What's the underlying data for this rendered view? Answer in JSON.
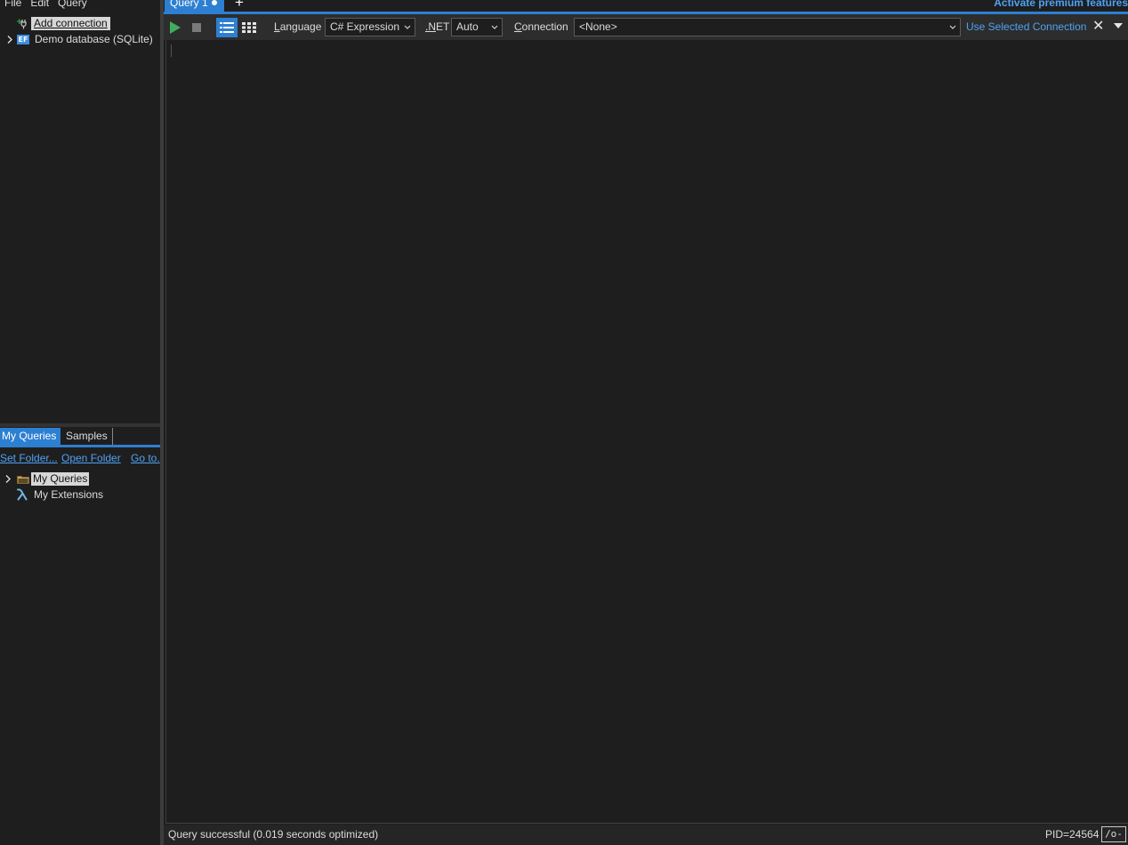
{
  "menu": [
    "File",
    "Edit",
    "Query"
  ],
  "connections": {
    "add_label": "Add connection",
    "items": [
      {
        "label": "Demo database (SQLite)",
        "badge": "EF"
      }
    ]
  },
  "query_panel": {
    "tabs": [
      "My Queries",
      "Samples"
    ],
    "links": [
      "Set Folder...",
      "Open Folder",
      "Go to."
    ],
    "tree": [
      {
        "label": "My Queries",
        "icon": "folder-icon"
      },
      {
        "label": "My Extensions",
        "icon": "lambda-icon"
      }
    ]
  },
  "tabs": {
    "active": "Query 1",
    "new_tab_symbol": "+",
    "premium_label": "Activate premium features"
  },
  "toolbar": {
    "language_label_u": "L",
    "language_label_rest": "anguage",
    "language_value": "C# Expression",
    "net_label_u": ".N",
    "net_label_rest": "ET",
    "net_value": "Auto",
    "connection_label_u": "C",
    "connection_label_rest": "onnection",
    "connection_value": "<None>",
    "use_selected": "Use Selected Connection",
    "close_symbol": "✕"
  },
  "status": {
    "text": "Query successful  (0.019 seconds optimized)",
    "pid": "PID=24564",
    "toggle": "/o-"
  },
  "colors": {
    "accent": "#2d7fd1",
    "link": "#4ea2f5",
    "background": "#1e1e1e",
    "run": "#3fae5a"
  }
}
